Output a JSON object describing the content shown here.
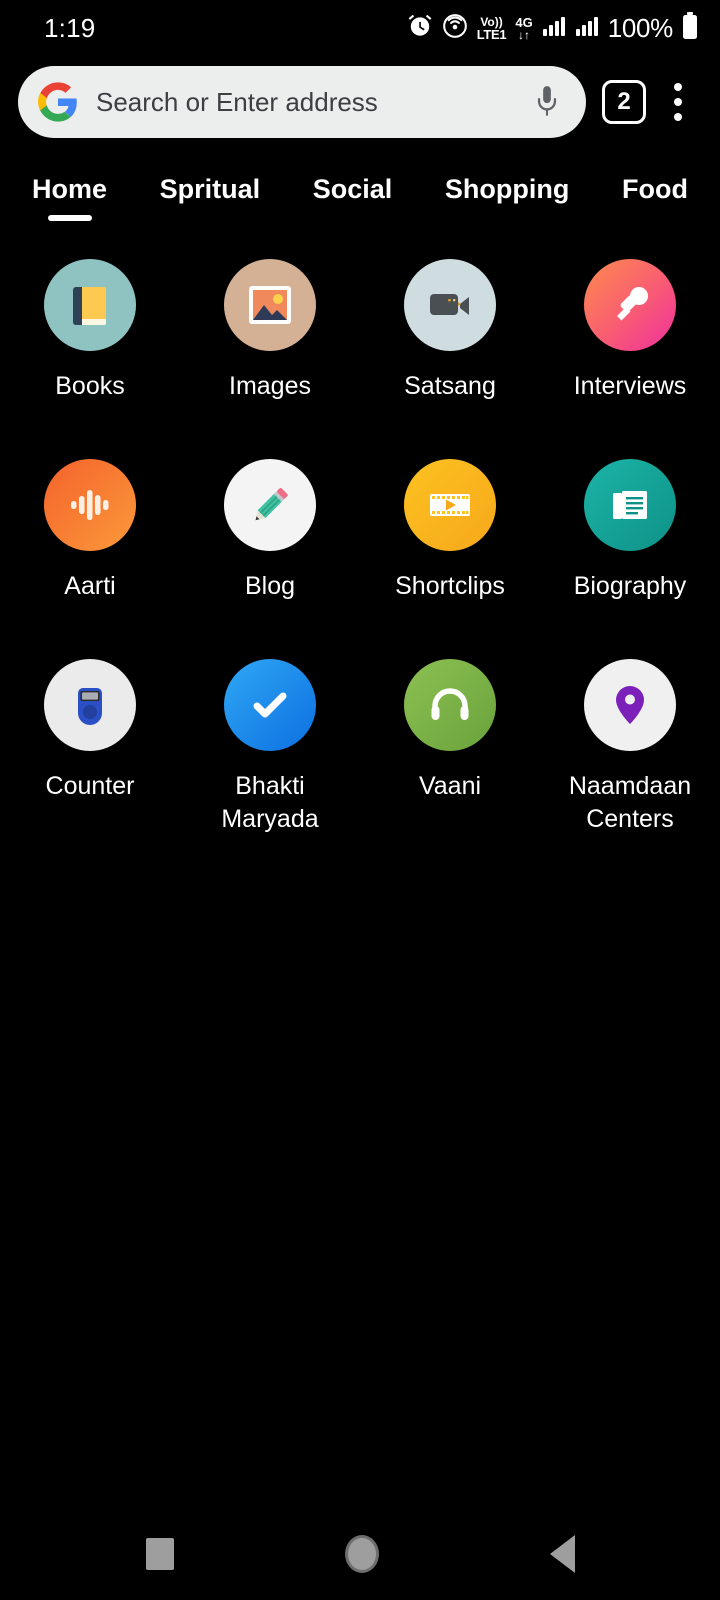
{
  "statusbar": {
    "time": "1:19",
    "alarm_icon": "alarm-icon",
    "hotspot_icon": "hotspot-icon",
    "volte_line1": "Vo))",
    "volte_line2": "LTE1",
    "network_type": "4G",
    "data_arrows": "↓↑",
    "signal_icon_1": "signal-bars-icon",
    "signal_icon_2": "signal-bars-icon",
    "battery_percent": "100%",
    "battery_icon": "battery-full-icon"
  },
  "omnibox": {
    "google_icon": "google-g-icon",
    "placeholder": "Search or Enter address",
    "value": "",
    "mic_icon": "microphone-icon",
    "tab_count": "2",
    "overflow_icon": "overflow-menu-icon"
  },
  "tabs": [
    {
      "label": "Home",
      "active": true
    },
    {
      "label": "Spritual",
      "active": false
    },
    {
      "label": "Social",
      "active": false
    },
    {
      "label": "Shopping",
      "active": false
    },
    {
      "label": "Food",
      "active": false
    }
  ],
  "apps": [
    {
      "label": "Books",
      "icon": "book-icon",
      "bg": "#8fc3c2"
    },
    {
      "label": "Images",
      "icon": "photo-icon",
      "bg": "#d4b094"
    },
    {
      "label": "Satsang",
      "icon": "video-camera-icon",
      "bg": "#cfdde1"
    },
    {
      "label": "Interviews",
      "icon": "microphone-icon",
      "bg": "#fb7f55"
    },
    {
      "label": "Aarti",
      "icon": "audio-wave-icon",
      "bg": "#f4692e"
    },
    {
      "label": "Blog",
      "icon": "pencil-icon",
      "bg": "#f4f4f4"
    },
    {
      "label": "Shortclips",
      "icon": "film-play-icon",
      "bg": "#fbbd19"
    },
    {
      "label": "Biography",
      "icon": "document-icon",
      "bg": "#12a79d"
    },
    {
      "label": "Counter",
      "icon": "tally-counter-icon",
      "bg": "#ebebeb"
    },
    {
      "label": "Bhakti Maryada",
      "icon": "checkmark-icon",
      "bg": "#1a8fea"
    },
    {
      "label": "Vaani",
      "icon": "headphones-icon",
      "bg": "#79b martial"
    },
    {
      "label": "Naamdaan Centers",
      "icon": "map-pin-icon",
      "bg": "#f0f0f0"
    }
  ],
  "navbar": {
    "recents_icon": "recents-square-icon",
    "home_icon": "home-circle-icon",
    "back_icon": "back-triangle-icon"
  },
  "colors": {
    "page_bg": "#000000",
    "search_pill_bg": "#eceded",
    "text_primary": "#ffffff",
    "nav_icon": "#9e9e9e"
  }
}
